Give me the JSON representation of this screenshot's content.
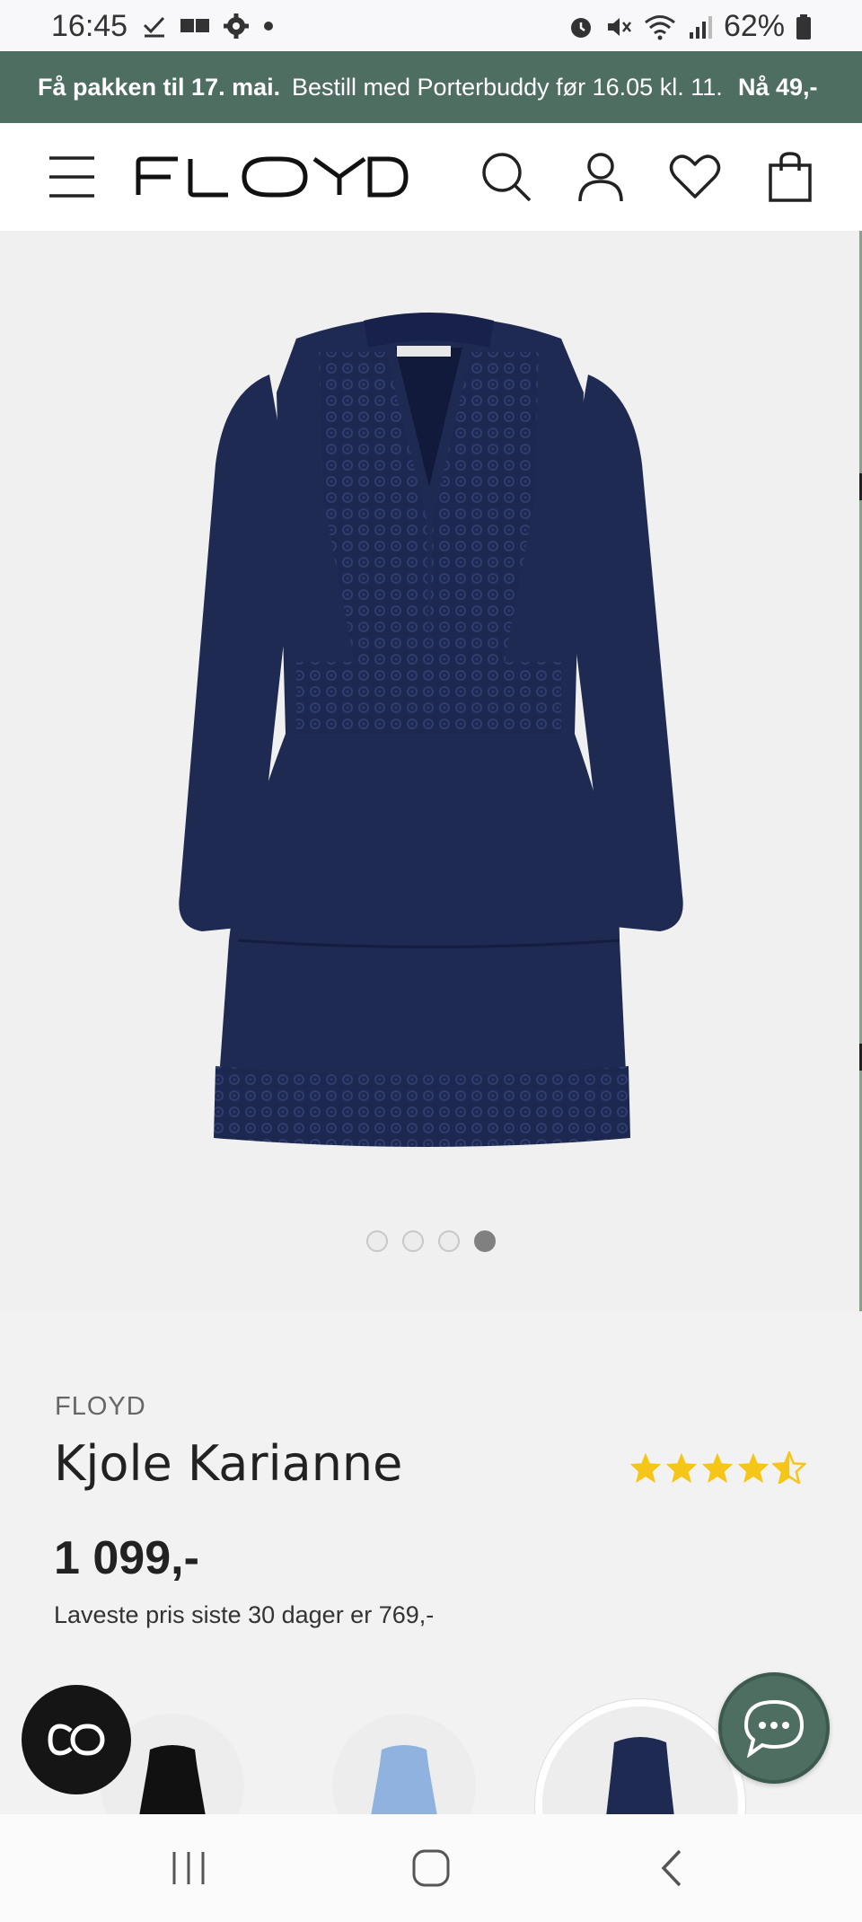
{
  "status_bar": {
    "time": "16:45",
    "battery": "62%",
    "left_icons": [
      "check-icon",
      "message-icon",
      "gear-icon",
      "dot-icon"
    ],
    "right_icons": [
      "alarm-icon",
      "mute-icon",
      "wifi-icon",
      "signal-icon",
      "battery-icon"
    ]
  },
  "promo": {
    "part1": "Få pakken til 17. mai.",
    "part2": "Bestill med Porterbuddy før 16.05 kl. 11.",
    "part3": "Nå 49,-"
  },
  "header": {
    "logo": "FLOYD",
    "icons": [
      "menu-icon",
      "search-icon",
      "account-icon",
      "heart-icon",
      "bag-icon"
    ]
  },
  "gallery": {
    "image_count": 4,
    "active_index": 4
  },
  "product": {
    "brand": "FLOYD",
    "title": "Kjole Karianne",
    "rating": 4.5,
    "rating_max": 5,
    "price": "1 099,-",
    "lowest_price_note": "Laveste pris siste 30 dager er 769,-"
  },
  "swatches": {
    "colors": [
      "black",
      "light-blue",
      "navy"
    ],
    "selected": 2
  },
  "colors": {
    "brand_green": "#4e6e62",
    "dress_navy": "#1f2a52",
    "star_yellow": "#f5c518"
  },
  "nav": {
    "icons": [
      "recents-icon",
      "home-icon",
      "back-icon"
    ]
  }
}
